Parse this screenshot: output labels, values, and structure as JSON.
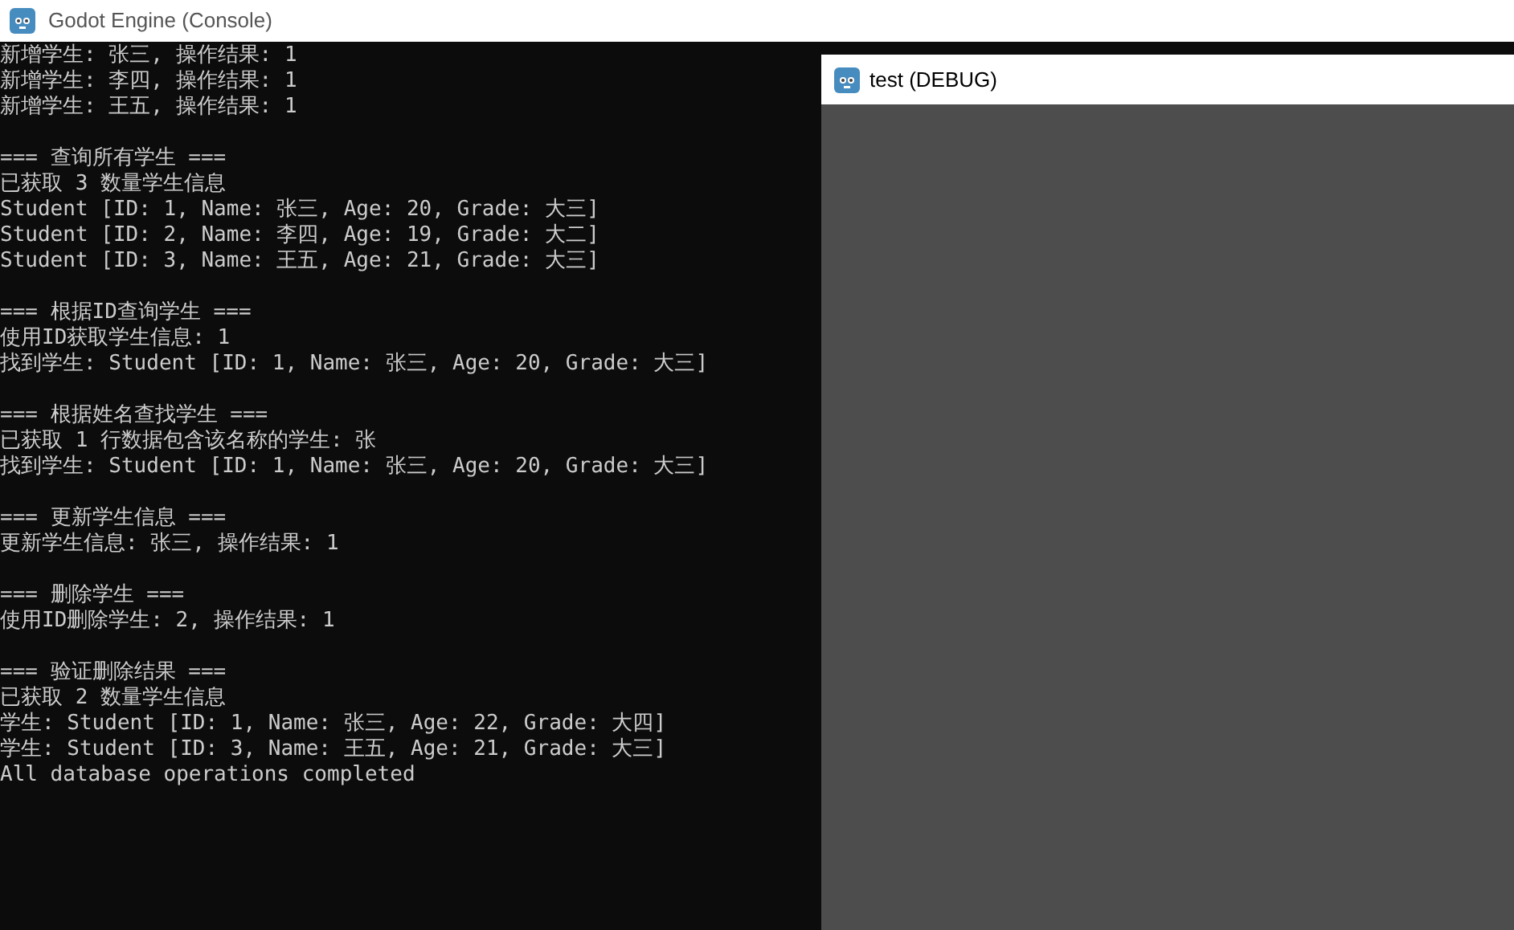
{
  "console_window": {
    "title": "Godot Engine (Console)",
    "blocks": [
      {
        "lines": [
          "新增学生: 张三, 操作结果: 1",
          "新增学生: 李四, 操作结果: 1",
          "新增学生: 王五, 操作结果: 1"
        ]
      },
      {
        "lines": [
          "=== 查询所有学生 ===",
          "已获取 3 数量学生信息",
          "Student [ID: 1, Name: 张三, Age: 20, Grade: 大三]",
          "Student [ID: 2, Name: 李四, Age: 19, Grade: 大二]",
          "Student [ID: 3, Name: 王五, Age: 21, Grade: 大三]"
        ]
      },
      {
        "lines": [
          "=== 根据ID查询学生 ===",
          "使用ID获取学生信息: 1",
          "找到学生: Student [ID: 1, Name: 张三, Age: 20, Grade: 大三]"
        ]
      },
      {
        "lines": [
          "=== 根据姓名查找学生 ===",
          "已获取 1 行数据包含该名称的学生: 张",
          "找到学生: Student [ID: 1, Name: 张三, Age: 20, Grade: 大三]"
        ]
      },
      {
        "lines": [
          "=== 更新学生信息 ===",
          "更新学生信息: 张三, 操作结果: 1"
        ]
      },
      {
        "lines": [
          "=== 删除学生 ===",
          "使用ID删除学生: 2, 操作结果: 1"
        ]
      },
      {
        "lines": [
          "=== 验证删除结果 ===",
          "已获取 2 数量学生信息",
          "学生: Student [ID: 1, Name: 张三, Age: 22, Grade: 大四]",
          "学生: Student [ID: 3, Name: 王五, Age: 21, Grade: 大三]",
          "All database operations completed"
        ]
      }
    ]
  },
  "debug_window": {
    "title": "test (DEBUG)"
  }
}
